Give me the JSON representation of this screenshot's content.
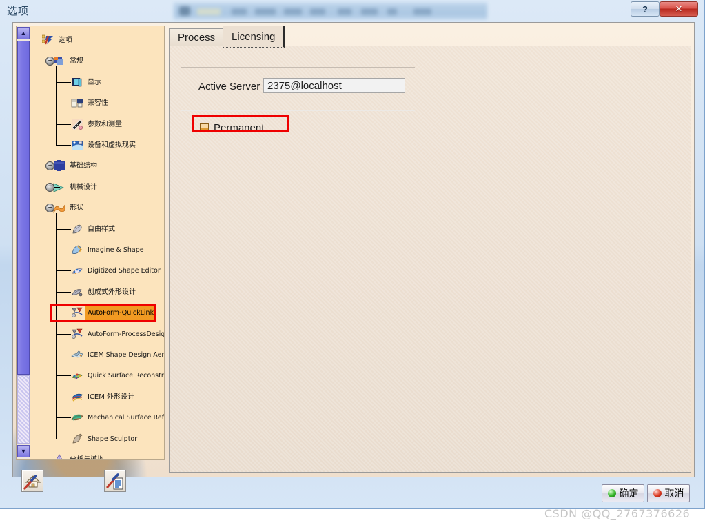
{
  "window": {
    "title": "选项",
    "help_button": "?",
    "close_button": "✕"
  },
  "tree": {
    "scroll_up": "▲",
    "scroll_down": "▼",
    "selected_item": "AutoForm-QuickLink",
    "nodes": [
      {
        "label": "选项",
        "icon": "options-icon",
        "depth": 0,
        "expander": ""
      },
      {
        "label": "常规",
        "icon": "general-icon",
        "depth": 1,
        "expander": "−"
      },
      {
        "label": "显示",
        "icon": "display-icon",
        "depth": 2,
        "expander": ""
      },
      {
        "label": "兼容性",
        "icon": "compatibility-icon",
        "depth": 2,
        "expander": ""
      },
      {
        "label": "参数和测量",
        "icon": "parameters-measure-icon",
        "depth": 2,
        "expander": ""
      },
      {
        "label": "设备和虚拟现实",
        "icon": "devices-virtual-reality-icon",
        "depth": 2,
        "expander": ""
      },
      {
        "label": "基础结构",
        "icon": "infrastructure-icon",
        "depth": 1,
        "expander": "+"
      },
      {
        "label": "机械设计",
        "icon": "mechanical-design-icon",
        "depth": 1,
        "expander": "+"
      },
      {
        "label": "形状",
        "icon": "shape-icon",
        "depth": 1,
        "expander": "−"
      },
      {
        "label": "自由样式",
        "icon": "freestyle-icon",
        "depth": 2,
        "expander": ""
      },
      {
        "label": "Imagine & Shape",
        "icon": "imagine-and-shape-icon",
        "depth": 2,
        "expander": ""
      },
      {
        "label": "Digitized Shape Editor",
        "icon": "digitized-shape-editor-icon",
        "depth": 2,
        "expander": ""
      },
      {
        "label": "创成式外形设计",
        "icon": "generative-shape-design-icon",
        "depth": 2,
        "expander": ""
      },
      {
        "label": "AutoForm-QuickLink",
        "icon": "autoform-quicklink-icon",
        "depth": 2,
        "expander": ""
      },
      {
        "label": "AutoForm-ProcessDesigner",
        "icon": "autoform-processdesigner-icon",
        "depth": 2,
        "expander": ""
      },
      {
        "label": "ICEM Shape Design AeroExpert",
        "icon": "icem-shape-design-aeroexpert-icon",
        "depth": 2,
        "expander": ""
      },
      {
        "label": "Quick Surface Reconstruction",
        "icon": "quick-surface-reconstruction-icon",
        "depth": 2,
        "expander": ""
      },
      {
        "label": "ICEM 外形设计",
        "icon": "icem-shape-design-icon",
        "depth": 2,
        "expander": ""
      },
      {
        "label": "Mechanical Surface Refinement",
        "icon": "mechanical-surface-refinement-icon",
        "depth": 2,
        "expander": ""
      },
      {
        "label": "Shape Sculptor",
        "icon": "shape-sculptor-icon",
        "depth": 2,
        "expander": ""
      },
      {
        "label": "分析与模拟",
        "icon": "analysis-simulation-icon",
        "depth": 1,
        "expander": ""
      }
    ],
    "toolbar": [
      {
        "name": "reset-to-defaults-button"
      },
      {
        "name": "edit-settings-button"
      }
    ]
  },
  "content": {
    "tabs": [
      {
        "label": "Process",
        "active": false
      },
      {
        "label": "Licensing",
        "active": true
      }
    ],
    "active_server": {
      "label": "Active Server",
      "value": "2375@localhost"
    },
    "license": {
      "type_label": "Permanent",
      "icon": "license-square-icon"
    }
  },
  "footer": {
    "ok_label": "确定",
    "cancel_label": "取消"
  },
  "watermark": "CSDN @QQ_2767376626",
  "colors": {
    "tree_bg": "#fce4bd",
    "panel_bg": "#efe2d4",
    "highlight_border": "#ef0000",
    "selection_bg": "#f29a22",
    "scrollbar_thumb": "#7b76e4"
  }
}
